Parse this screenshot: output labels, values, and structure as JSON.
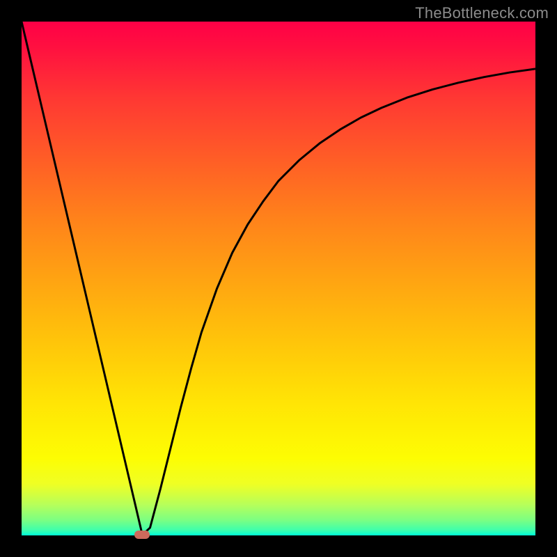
{
  "watermark": "TheBottleneck.com",
  "colors": {
    "curve_stroke": "#000000",
    "marker_fill": "#cc6a5c",
    "frame_bg": "#000000"
  },
  "chart_data": {
    "type": "line",
    "title": "",
    "xlabel": "",
    "ylabel": "",
    "xlim": [
      0,
      100
    ],
    "ylim": [
      0,
      100
    ],
    "grid": false,
    "legend": false,
    "series": [
      {
        "name": "bottleneck-curve",
        "x": [
          0,
          2,
          4,
          6,
          8,
          10,
          12,
          14,
          16,
          18,
          20,
          22,
          23.5,
          25,
          27,
          29,
          31,
          33,
          35,
          38,
          41,
          44,
          47,
          50,
          54,
          58,
          62,
          66,
          70,
          75,
          80,
          85,
          90,
          95,
          100
        ],
        "y": [
          100,
          91.5,
          83,
          74.5,
          66,
          57.5,
          49,
          40.5,
          32,
          23.5,
          15,
          6.5,
          0.1,
          1.5,
          9,
          17,
          25,
          32.5,
          39.5,
          48,
          55,
          60.5,
          65,
          69,
          73,
          76.3,
          79,
          81.3,
          83.2,
          85.2,
          86.8,
          88.1,
          89.2,
          90.1,
          90.8
        ]
      }
    ],
    "marker": {
      "x": 23.5,
      "y": 0.1,
      "w": 3.0,
      "h": 1.6
    },
    "background_gradient": [
      {
        "pos": 0.0,
        "hex": "#ff0046"
      },
      {
        "pos": 0.5,
        "hex": "#ffa312"
      },
      {
        "pos": 0.85,
        "hex": "#fdfd03"
      },
      {
        "pos": 1.0,
        "hex": "#00ffd8"
      }
    ]
  },
  "layout": {
    "image_size": 800,
    "frame_inset": 31,
    "plot_size": 738
  }
}
